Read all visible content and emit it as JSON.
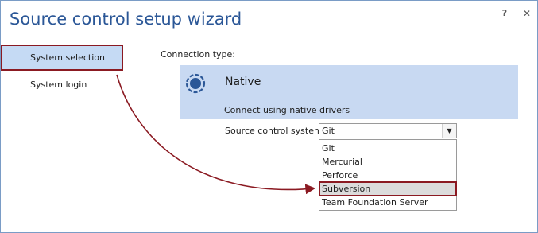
{
  "window": {
    "title": "Source control setup wizard",
    "help_glyph": "?",
    "close_glyph": "✕"
  },
  "sidebar": {
    "items": [
      {
        "label": "System selection",
        "selected": true
      },
      {
        "label": "System login",
        "selected": false
      }
    ]
  },
  "main": {
    "connection_type_label": "Connection type:",
    "native": {
      "title": "Native",
      "description": "Connect using native drivers",
      "icon": "native-driver-icon"
    },
    "source_control_label": "Source control system",
    "combo": {
      "value": "Git"
    },
    "dropdown": {
      "options": [
        "Git",
        "Mercurial",
        "Perforce",
        "Subversion",
        "Team Foundation Server"
      ],
      "highlighted": "Subversion"
    }
  },
  "colors": {
    "title": "#2b5797",
    "selection": "#c5daf4",
    "panel": "#c8d9f2",
    "annotation": "#8b1a22"
  }
}
